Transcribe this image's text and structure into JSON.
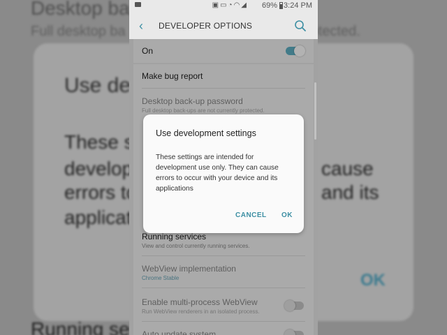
{
  "status_bar": {
    "battery": "69%",
    "time": "3:24 PM",
    "icons": [
      "camera-icon",
      "sim-icon",
      "cast-icon",
      "alarm-icon",
      "wifi-icon",
      "signal-icon",
      "battery-icon"
    ]
  },
  "app_bar": {
    "title": "DEVELOPER OPTIONS"
  },
  "master_switch": {
    "label": "On",
    "enabled": true
  },
  "settings": {
    "bug_report": "Make bug report",
    "backup_password": {
      "label": "Desktop back-up password",
      "desc": "Full desktop back-ups are not currently protected."
    },
    "running_services": {
      "label": "Running services",
      "desc": "View and control currently running services."
    },
    "webview": {
      "label": "WebView implementation",
      "value": "Chrome Stable"
    },
    "multiprocess": {
      "label": "Enable multi-process WebView",
      "desc": "Run WebView renderers in an isolated process."
    },
    "auto_update": {
      "label": "Auto update system"
    }
  },
  "dialog": {
    "title": "Use development settings",
    "body": "These settings are intended for development use only. They can cause errors to occur with your device and its applications",
    "cancel_label": "CANCEL",
    "ok_label": "OK"
  },
  "background": {
    "top_title": "Desktop ba",
    "top_sub": "Full desktop ba",
    "top_sub_right": "rotected.",
    "dlg_title": "Use dev",
    "line1": "These se",
    "line2": "developm",
    "line2_right": "cause",
    "line3": "errors to",
    "line3_right": "and its",
    "line4": "applicati",
    "ok": "OK",
    "bottom": "Running ser"
  },
  "colors": {
    "accent": "#3d8fa3",
    "toggle_on": "#5fb0c4"
  }
}
